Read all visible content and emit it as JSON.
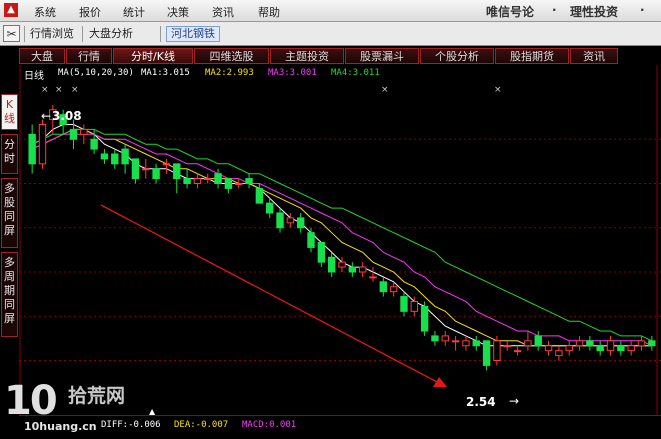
{
  "app": {
    "menu": [
      "系统",
      "报价",
      "统计",
      "决策",
      "资讯",
      "帮助"
    ],
    "brand_right": [
      "唯信号论",
      "理性投资"
    ]
  },
  "toolbar": {
    "tool_icon": "scissors-icon",
    "buttons": [
      "行情浏览",
      "大盘分析",
      "河北钢铁"
    ],
    "active": "河北钢铁"
  },
  "tabs": [
    "大盘",
    "行情",
    "分时/K线",
    "四维选股",
    "主题投资",
    "股票漏斗",
    "个股分析",
    "股指期货",
    "资讯"
  ],
  "active_tab": "分时/K线",
  "side_tabs": [
    "K线",
    "分时",
    "多股同屏",
    "多周期同屏"
  ],
  "active_side_tab": "K线",
  "chart_header": {
    "period_label": "日线",
    "ma_param": "MA(5,10,20,30)",
    "ma1": "MA1:3.015",
    "ma2": "MA2:2.993",
    "ma3": "MA3:3.001",
    "ma4": "MA4:3.011"
  },
  "price_annotations": {
    "high": "3.08",
    "low": "2.54"
  },
  "macd": {
    "diff": "DIFF:-0.006",
    "dea": "DEA:-0.007",
    "macd": "MACD:0.001"
  },
  "watermark": {
    "number": "10",
    "site": "拾荒网",
    "domain": "10huang.cn"
  },
  "colors": {
    "up": "#ff3b3b",
    "down": "#17e04b",
    "ma1": "#ffffff",
    "ma2": "#ffe000",
    "ma3": "#ff33ff",
    "ma4": "#22d822",
    "grid": "#8b0000",
    "trend_arrow": "#e01818"
  },
  "chart_data": {
    "type": "candlestick",
    "title": "日线",
    "ylim": [
      2.5,
      3.1
    ],
    "candles": [
      [
        3.02,
        2.96,
        3.04,
        2.94
      ],
      [
        2.96,
        3.04,
        3.05,
        2.95
      ],
      [
        3.05,
        3.07,
        3.08,
        3.02
      ],
      [
        3.06,
        3.04,
        3.07,
        3.02
      ],
      [
        3.03,
        3.01,
        3.05,
        2.99
      ],
      [
        3.02,
        3.03,
        3.04,
        3.0
      ],
      [
        3.01,
        2.99,
        3.03,
        2.98
      ],
      [
        2.98,
        2.97,
        2.99,
        2.96
      ],
      [
        2.98,
        2.96,
        2.99,
        2.95
      ],
      [
        2.99,
        2.96,
        3.0,
        2.94
      ],
      [
        2.97,
        2.93,
        2.97,
        2.92
      ],
      [
        2.95,
        2.95,
        2.97,
        2.93
      ],
      [
        2.95,
        2.93,
        2.96,
        2.92
      ],
      [
        2.96,
        2.96,
        2.97,
        2.94
      ],
      [
        2.96,
        2.93,
        2.96,
        2.9
      ],
      [
        2.93,
        2.92,
        2.95,
        2.91
      ],
      [
        2.92,
        2.93,
        2.94,
        2.91
      ],
      [
        2.93,
        2.93,
        2.94,
        2.92
      ],
      [
        2.94,
        2.92,
        2.95,
        2.91
      ],
      [
        2.93,
        2.91,
        2.93,
        2.9
      ],
      [
        2.92,
        2.92,
        2.93,
        2.91
      ],
      [
        2.93,
        2.92,
        2.94,
        2.91
      ],
      [
        2.91,
        2.88,
        2.92,
        2.88
      ],
      [
        2.88,
        2.86,
        2.89,
        2.85
      ],
      [
        2.86,
        2.83,
        2.87,
        2.82
      ],
      [
        2.84,
        2.85,
        2.86,
        2.83
      ],
      [
        2.85,
        2.83,
        2.86,
        2.82
      ],
      [
        2.82,
        2.79,
        2.83,
        2.78
      ],
      [
        2.8,
        2.76,
        2.8,
        2.75
      ],
      [
        2.77,
        2.74,
        2.78,
        2.73
      ],
      [
        2.75,
        2.76,
        2.77,
        2.74
      ],
      [
        2.75,
        2.74,
        2.76,
        2.73
      ],
      [
        2.74,
        2.75,
        2.76,
        2.73
      ],
      [
        2.73,
        2.73,
        2.75,
        2.72
      ],
      [
        2.72,
        2.7,
        2.73,
        2.69
      ],
      [
        2.7,
        2.71,
        2.72,
        2.69
      ],
      [
        2.69,
        2.66,
        2.7,
        2.65
      ],
      [
        2.66,
        2.68,
        2.69,
        2.65
      ],
      [
        2.67,
        2.62,
        2.68,
        2.61
      ],
      [
        2.61,
        2.6,
        2.62,
        2.59
      ],
      [
        2.6,
        2.61,
        2.62,
        2.59
      ],
      [
        2.6,
        2.6,
        2.61,
        2.58
      ],
      [
        2.59,
        2.6,
        2.61,
        2.58
      ],
      [
        2.6,
        2.59,
        2.61,
        2.58
      ],
      [
        2.6,
        2.55,
        2.6,
        2.54
      ],
      [
        2.56,
        2.6,
        2.61,
        2.55
      ],
      [
        2.59,
        2.59,
        2.6,
        2.58
      ],
      [
        2.58,
        2.58,
        2.59,
        2.57
      ],
      [
        2.59,
        2.6,
        2.62,
        2.58
      ],
      [
        2.61,
        2.59,
        2.62,
        2.58
      ],
      [
        2.58,
        2.59,
        2.6,
        2.57
      ],
      [
        2.57,
        2.58,
        2.59,
        2.56
      ],
      [
        2.58,
        2.59,
        2.6,
        2.57
      ],
      [
        2.59,
        2.6,
        2.61,
        2.58
      ],
      [
        2.6,
        2.59,
        2.61,
        2.58
      ],
      [
        2.59,
        2.58,
        2.6,
        2.57
      ],
      [
        2.58,
        2.6,
        2.61,
        2.57
      ],
      [
        2.59,
        2.58,
        2.6,
        2.57
      ],
      [
        2.58,
        2.59,
        2.6,
        2.57
      ],
      [
        2.59,
        2.6,
        2.61,
        2.58
      ],
      [
        2.6,
        2.59,
        2.61,
        2.58
      ]
    ],
    "ma_lines": [
      {
        "name": "MA1",
        "values": [
          3.0,
          3.01,
          3.03,
          3.04,
          3.04,
          3.03,
          3.02,
          3.0,
          2.99,
          2.98,
          2.96,
          2.95,
          2.95,
          2.95,
          2.94,
          2.93,
          2.93,
          2.93,
          2.92,
          2.92,
          2.92,
          2.92,
          2.91,
          2.89,
          2.87,
          2.85,
          2.84,
          2.82,
          2.8,
          2.78,
          2.76,
          2.75,
          2.75,
          2.74,
          2.73,
          2.72,
          2.7,
          2.68,
          2.67,
          2.65,
          2.63,
          2.62,
          2.61,
          2.6,
          2.59,
          2.59,
          2.59,
          2.59,
          2.59,
          2.59,
          2.59,
          2.59,
          2.59,
          2.59,
          2.59,
          2.59,
          2.59,
          2.59,
          2.59,
          2.59,
          2.59
        ]
      },
      {
        "name": "MA2",
        "values": [
          2.99,
          3.0,
          3.01,
          3.02,
          3.03,
          3.03,
          3.02,
          3.01,
          3.01,
          3.0,
          2.99,
          2.98,
          2.97,
          2.96,
          2.95,
          2.95,
          2.94,
          2.93,
          2.93,
          2.93,
          2.92,
          2.92,
          2.91,
          2.9,
          2.89,
          2.88,
          2.87,
          2.85,
          2.84,
          2.82,
          2.8,
          2.79,
          2.78,
          2.76,
          2.75,
          2.74,
          2.72,
          2.71,
          2.69,
          2.67,
          2.66,
          2.64,
          2.63,
          2.62,
          2.61,
          2.6,
          2.6,
          2.6,
          2.59,
          2.59,
          2.59,
          2.59,
          2.59,
          2.59,
          2.59,
          2.59,
          2.59,
          2.59,
          2.59,
          2.59,
          2.59
        ]
      },
      {
        "name": "MA3",
        "values": [
          2.99,
          3.0,
          3.01,
          3.02,
          3.02,
          3.02,
          3.02,
          3.01,
          3.01,
          3.01,
          3.0,
          2.99,
          2.98,
          2.98,
          2.97,
          2.96,
          2.96,
          2.95,
          2.94,
          2.93,
          2.93,
          2.92,
          2.92,
          2.91,
          2.9,
          2.89,
          2.88,
          2.87,
          2.86,
          2.85,
          2.84,
          2.82,
          2.81,
          2.8,
          2.78,
          2.77,
          2.76,
          2.74,
          2.73,
          2.71,
          2.7,
          2.69,
          2.68,
          2.66,
          2.65,
          2.64,
          2.63,
          2.62,
          2.62,
          2.61,
          2.61,
          2.61,
          2.6,
          2.6,
          2.6,
          2.6,
          2.6,
          2.6,
          2.6,
          2.6,
          2.59
        ]
      },
      {
        "name": "MA4",
        "values": [
          3.0,
          3.01,
          3.02,
          3.02,
          3.03,
          3.03,
          3.03,
          3.02,
          3.02,
          3.02,
          3.01,
          3.0,
          3.0,
          2.99,
          2.99,
          2.98,
          2.97,
          2.97,
          2.96,
          2.96,
          2.95,
          2.94,
          2.94,
          2.93,
          2.92,
          2.91,
          2.9,
          2.89,
          2.88,
          2.87,
          2.87,
          2.86,
          2.85,
          2.84,
          2.83,
          2.82,
          2.81,
          2.8,
          2.79,
          2.78,
          2.76,
          2.75,
          2.74,
          2.73,
          2.72,
          2.71,
          2.7,
          2.69,
          2.68,
          2.67,
          2.66,
          2.65,
          2.64,
          2.64,
          2.63,
          2.62,
          2.62,
          2.61,
          2.61,
          2.61,
          2.6
        ]
      }
    ]
  }
}
